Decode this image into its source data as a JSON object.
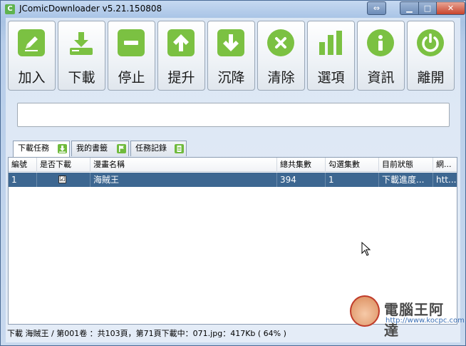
{
  "window": {
    "title": "JComicDownloader v5.21.150808",
    "app_icon_letter": "C",
    "close_glyph": "✕",
    "min_glyph": "▁",
    "max_glyph": "□",
    "restore_glyph": "⇔"
  },
  "toolbar": {
    "buttons": [
      {
        "label": "加入",
        "icon": "pencil-icon"
      },
      {
        "label": "下載",
        "icon": "download-icon"
      },
      {
        "label": "停止",
        "icon": "minus-icon"
      },
      {
        "label": "提升",
        "icon": "arrow-up-icon"
      },
      {
        "label": "沉降",
        "icon": "arrow-down-icon"
      },
      {
        "label": "清除",
        "icon": "x-circle-icon"
      },
      {
        "label": "選項",
        "icon": "bar-chart-icon"
      },
      {
        "label": "資訊",
        "icon": "info-icon"
      },
      {
        "label": "離開",
        "icon": "power-icon"
      }
    ]
  },
  "url_input": {
    "value": "",
    "placeholder": ""
  },
  "tabs": [
    {
      "label": "下載任務",
      "icon": "download-tab-icon",
      "active": true
    },
    {
      "label": "我的書籤",
      "icon": "flag-tab-icon",
      "active": false
    },
    {
      "label": "任務記錄",
      "icon": "doc-tab-icon",
      "active": false
    }
  ],
  "table": {
    "headers": [
      "編號",
      "是否下載",
      "漫畫名稱",
      "總共集數",
      "勾選集數",
      "目前狀態",
      "網..."
    ],
    "rows": [
      {
        "id": "1",
        "download": "☑",
        "name": "海賊王",
        "total": "394",
        "selected": "1",
        "status": "下載進度...",
        "url": "htt..."
      }
    ]
  },
  "status": {
    "text": "下載 海賊王 / 第001卷 ：共103頁，第71頁下載中：071.jpg：417Kb ( 64% )"
  },
  "watermark": {
    "title": "電腦王阿達",
    "url": "http://www.kocpc.com.tw"
  },
  "colors": {
    "icon_green": "#7bc142",
    "selection_blue": "#3d6791"
  }
}
